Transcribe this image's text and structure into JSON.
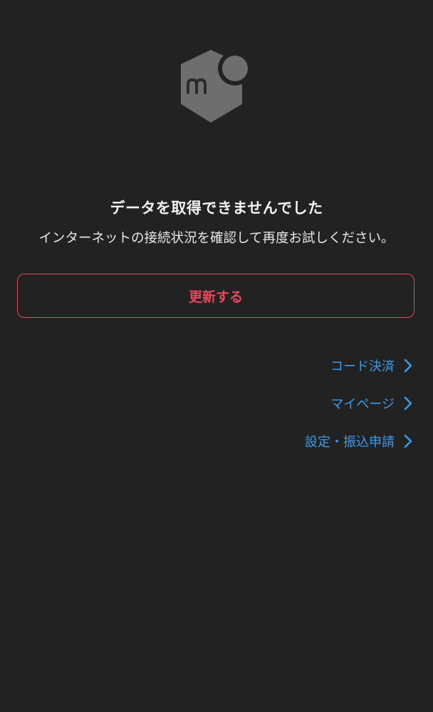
{
  "logo": {
    "icon": "mercari-box-logo-icon",
    "color": "#6e6e6e"
  },
  "error": {
    "title": "データを取得できませんでした",
    "message": "インターネットの接続状況を確認して再度お試しください。"
  },
  "actions": {
    "refresh_label": "更新する"
  },
  "links": [
    {
      "label": "コード決済",
      "icon": "chevron-right-icon"
    },
    {
      "label": "マイページ",
      "icon": "chevron-right-icon"
    },
    {
      "label": "設定・振込申請",
      "icon": "chevron-right-icon"
    }
  ],
  "colors": {
    "background": "#222222",
    "accent_red": "#e8485e",
    "link_blue": "#3d9ae8"
  }
}
